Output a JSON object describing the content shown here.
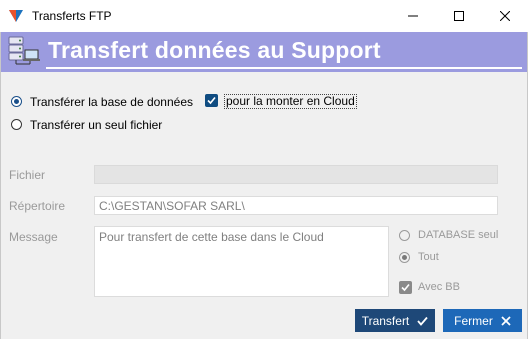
{
  "window": {
    "title": "Transferts FTP"
  },
  "banner": {
    "title": "Transfert données au Support"
  },
  "options": {
    "radio_database": "Transférer la base de données",
    "radio_single_file": "Transférer un seul fichier",
    "checkbox_cloud": "pour la monter en Cloud"
  },
  "form": {
    "fichier_label": "Fichier",
    "fichier_value": "",
    "repertoire_label": "Répertoire",
    "repertoire_value": "C:\\GESTAN\\SOFAR SARL\\",
    "message_label": "Message",
    "message_value": "Pour transfert de cette base dans le Cloud"
  },
  "side_options": {
    "database_seul": "DATABASE seul",
    "tout": "Tout",
    "avec_bb": "Avec BB"
  },
  "buttons": {
    "transfert": "Transfert",
    "fermer": "Fermer"
  },
  "colors": {
    "banner": "#9b9bdf",
    "primary_button": "#1e4878",
    "secondary_button": "#1d68b8",
    "accent": "#0f4c81"
  }
}
